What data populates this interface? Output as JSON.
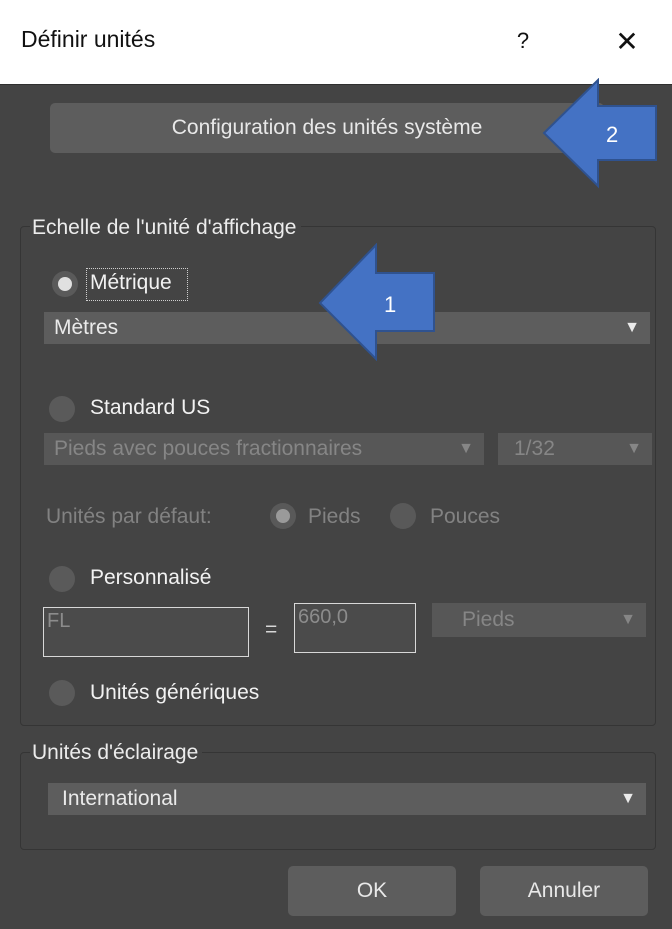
{
  "window": {
    "title": "Définir unités",
    "help_label": "?",
    "close_label": "✕"
  },
  "system_units_button": "Configuration des unités système",
  "display_scale": {
    "title": "Echelle de l'unité d'affichage",
    "metric": {
      "label": "Métrique",
      "selected": true,
      "combo_value": "Mètres"
    },
    "us_standard": {
      "label": "Standard US",
      "selected": false,
      "combo_value": "Pieds avec pouces fractionnaires",
      "fraction_value": "1/32",
      "default_units_label": "Unités par défaut:",
      "feet_label": "Pieds",
      "inches_label": "Pouces"
    },
    "custom": {
      "label": "Personnalisé",
      "selected": false,
      "name_value": "FL",
      "equals": "=",
      "amount_value": "660,0",
      "unit_value": "Pieds"
    },
    "generic": {
      "label": "Unités génériques",
      "selected": false
    }
  },
  "lighting_units": {
    "title": "Unités d'éclairage",
    "combo_value": "International"
  },
  "buttons": {
    "ok": "OK",
    "cancel": "Annuler"
  },
  "annotations": {
    "callout_1": "1",
    "callout_2": "2",
    "callout_color": "#4472c4"
  },
  "icons": {
    "dropdown_arrow": "▼"
  }
}
